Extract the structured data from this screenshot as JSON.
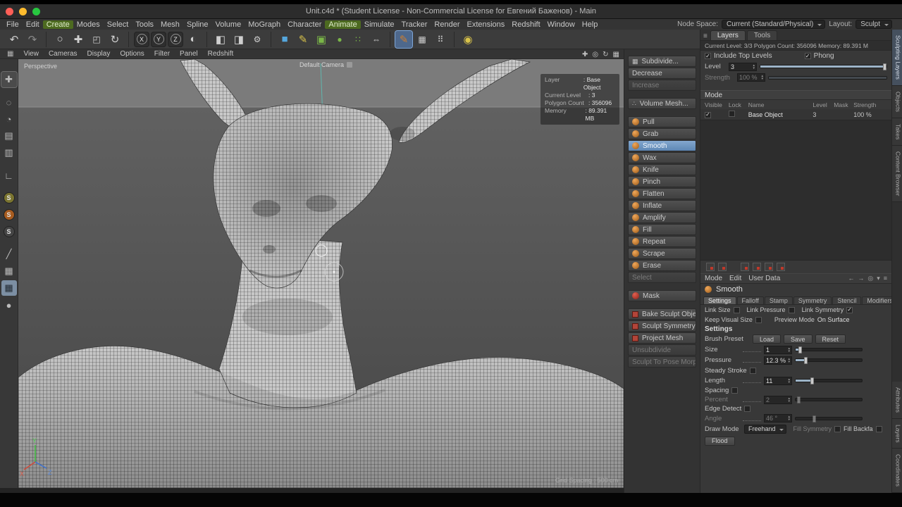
{
  "titlebar": {
    "title": "Unit.c4d * (Student License - Non-Commercial License for Евгений Баженов) - Main"
  },
  "menubar": {
    "items": [
      "File",
      "Edit",
      "Create",
      "Modes",
      "Select",
      "Tools",
      "Mesh",
      "Spline",
      "Volume",
      "MoGraph",
      "Character",
      "Animate",
      "Simulate",
      "Tracker",
      "Render",
      "Extensions",
      "Redshift",
      "Window",
      "Help"
    ],
    "node_space_label": "Node Space:",
    "node_space_value": "Current (Standard/Physical)",
    "layout_label": "Layout:",
    "layout_value": "Sculpt"
  },
  "toolbar": {
    "axis_x": "X",
    "axis_y": "Y",
    "axis_z": "Z"
  },
  "viewport_bar": {
    "items": [
      "View",
      "Cameras",
      "Display",
      "Options",
      "Filter",
      "Panel",
      "Redshift"
    ]
  },
  "viewport": {
    "view_name": "Perspective",
    "camera_label": "Default Camera",
    "hud_rows": [
      {
        "label": "Layer",
        "value": ": Base Object"
      },
      {
        "label": "Current Level",
        "value": ": 3"
      },
      {
        "label": "Polygon Count",
        "value": ": 356096"
      },
      {
        "label": "Memory",
        "value": ": 89.391 MB"
      }
    ],
    "grid_spacing": "Grid Spacing : 500 cm",
    "axis_x": "X",
    "axis_y": "Y",
    "axis_z": "Z"
  },
  "left_rail": {
    "s_badge": "S"
  },
  "sculpt_panel": {
    "subdivide": "Subdivide...",
    "decrease": "Decrease",
    "increase": "Increase",
    "volume_mesh": "Volume Mesh...",
    "tools": [
      "Pull",
      "Grab",
      "Smooth",
      "Wax",
      "Knife",
      "Pinch",
      "Flatten",
      "Inflate",
      "Amplify",
      "Fill",
      "Repeat",
      "Scrape",
      "Erase"
    ],
    "select_tool": "Select",
    "mask": "Mask",
    "actions": [
      "Bake Sculpt Objects",
      "Sculpt Symmetry",
      "Project Mesh",
      "Unsubdivide",
      "Sculpt To Pose Morph"
    ]
  },
  "layers_panel": {
    "tabs": [
      "Layers",
      "Tools"
    ],
    "info": "Current Level: 3/3    Polygon Count: 356096    Memory: 89.391 M",
    "include_top_levels": "Include Top Levels",
    "phong": "Phong",
    "level_label": "Level",
    "level_value": "3",
    "strength_label": "Strength",
    "strength_value": "100 %",
    "mode_header": "Mode",
    "columns": [
      "Visible",
      "Lock",
      "Name",
      "Level",
      "Mask",
      "Strength"
    ],
    "row_name": "Base Object",
    "row_level": "3",
    "row_strength": "100 %"
  },
  "attributes_panel": {
    "menu": [
      "Mode",
      "Edit",
      "User Data"
    ],
    "tool_title": "Smooth",
    "tabs": [
      "Settings",
      "Falloff",
      "Stamp",
      "Symmetry",
      "Stencil",
      "Modifiers"
    ],
    "link_size": "Link Size",
    "link_pressure": "Link Pressure",
    "link_symmetry": "Link Symmetry",
    "keep_visual_size": "Keep Visual Size",
    "preview_mode_label": "Preview Mode",
    "preview_mode_value": "On Surface",
    "settings_header": "Settings",
    "brush_preset_label": "Brush Preset",
    "load": "Load",
    "save": "Save",
    "reset": "Reset",
    "size_label": "Size",
    "size_value": "1",
    "pressure_label": "Pressure",
    "pressure_value": "12.3 %",
    "steady_stroke": "Steady Stroke",
    "length_label": "Length",
    "length_value": "11",
    "spacing": "Spacing",
    "percent_label": "Percent",
    "percent_value": "2",
    "edge_detect": "Edge Detect",
    "angle_label": "Angle",
    "angle_value": "46 °",
    "draw_mode_label": "Draw Mode",
    "draw_mode_value": "Freehand",
    "fill_symmetry": "Fill Symmetry",
    "fill_backface": "Fill Backfa",
    "flood": "Flood"
  },
  "side_tabs": {
    "top": [
      "Sculpting Layers",
      "Objects",
      "Takes",
      "Content Browser"
    ],
    "bottom": [
      "Attributes",
      "Layers",
      "Coordinates"
    ]
  },
  "icons": {
    "burger": "≡",
    "undo": "↶",
    "redo": "↷",
    "circle": "○",
    "move": "✚",
    "scale": "◰",
    "rotate": "↻",
    "globe": "◐",
    "render": "◧",
    "render_pv": "◨",
    "gear": "⚙",
    "cube": "■",
    "pen": "✎",
    "cube2": "▣",
    "sphere": "●",
    "cloner": "∷",
    "mirror": "⇔",
    "brush": "✎",
    "grid": "▦",
    "dots": "⠿",
    "lamp": "◉",
    "pan": "✚",
    "zoom": "◎",
    "orbit": "↻",
    "quad": "▦",
    "dotted_circle": "◌",
    "quarter": "◔",
    "sheet": "▤",
    "sheet2": "▥",
    "angle": "∟",
    "slash": "╱",
    "back": "←",
    "fwd": "→",
    "caret": "▾",
    "spin_up": "▴",
    "spin_down": "▾",
    "check": "✓",
    "subd": "▦",
    "voldots": "∴"
  },
  "colors": {
    "accent_blue": "#5d87b5",
    "active_tool_bg": "#6f95bf",
    "icon_orange": "#c97a2b",
    "icon_green": "#76b041",
    "icon_red": "#c0392b"
  }
}
